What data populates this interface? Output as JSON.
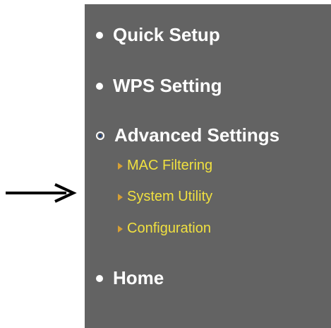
{
  "menu": {
    "items": [
      {
        "label": "Quick Setup",
        "state": "collapsed"
      },
      {
        "label": "WPS Setting",
        "state": "collapsed"
      },
      {
        "label": "Advanced Settings",
        "state": "expanded"
      },
      {
        "label": "Home",
        "state": "collapsed"
      }
    ],
    "submenu": [
      {
        "label": "MAC Filtering"
      },
      {
        "label": "System Utility"
      },
      {
        "label": "Configuration"
      }
    ]
  },
  "colors": {
    "panel_background": "#636363",
    "menu_text": "#ffffff",
    "submenu_text": "#f0e040",
    "submenu_marker": "#d7a034",
    "arrow": "#000000"
  },
  "icons": {
    "pointer": "arrow-right-icon",
    "item_marker": "bullet-icon",
    "expanded_marker": "open-bullet-icon",
    "submenu_marker": "triangle-right-icon"
  }
}
